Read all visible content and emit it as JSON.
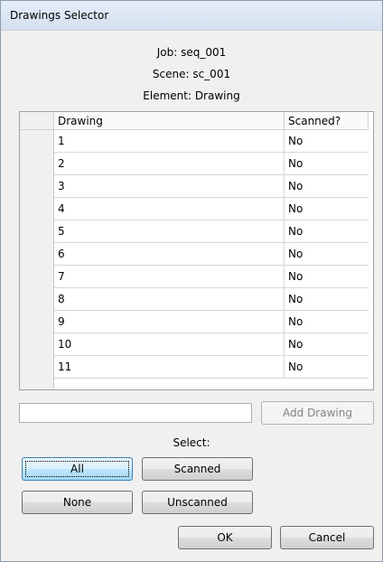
{
  "window": {
    "title": "Drawings Selector"
  },
  "info": {
    "job": "Job: seq_001",
    "scene": "Scene: sc_001",
    "element": "Element: Drawing"
  },
  "table": {
    "headers": {
      "drawing": "Drawing",
      "scanned": "Scanned?"
    },
    "rows": [
      {
        "drawing": "1",
        "scanned": "No"
      },
      {
        "drawing": "2",
        "scanned": "No"
      },
      {
        "drawing": "3",
        "scanned": "No"
      },
      {
        "drawing": "4",
        "scanned": "No"
      },
      {
        "drawing": "5",
        "scanned": "No"
      },
      {
        "drawing": "6",
        "scanned": "No"
      },
      {
        "drawing": "7",
        "scanned": "No"
      },
      {
        "drawing": "8",
        "scanned": "No"
      },
      {
        "drawing": "9",
        "scanned": "No"
      },
      {
        "drawing": "10",
        "scanned": "No"
      },
      {
        "drawing": "11",
        "scanned": "No"
      }
    ]
  },
  "add": {
    "input_value": "",
    "button_label": "Add Drawing"
  },
  "select": {
    "label": "Select:",
    "all": "All",
    "scanned": "Scanned",
    "none": "None",
    "unscanned": "Unscanned"
  },
  "footer": {
    "ok": "OK",
    "cancel": "Cancel"
  }
}
